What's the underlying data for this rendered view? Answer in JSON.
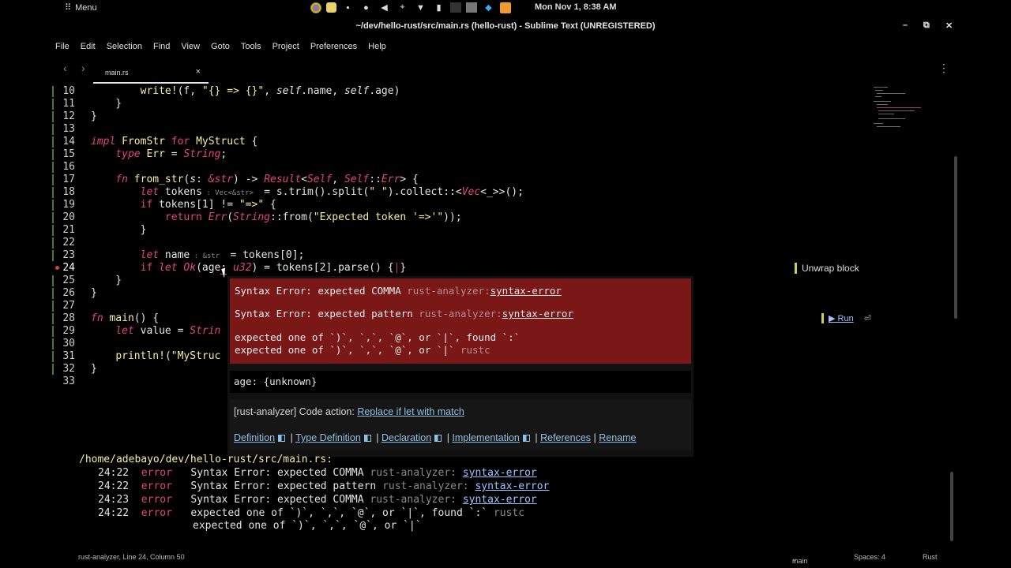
{
  "system": {
    "menu_label": "Menu",
    "clock": "Mon Nov  1,  8:38 AM",
    "tray_icons": [
      "chrome-icon",
      "camera-app-icon",
      "camera-icon",
      "microphone-icon",
      "volume-icon",
      "location-icon",
      "wifi-icon",
      "battery-icon",
      "terminal-icon",
      "files-icon",
      "vscode-icon",
      "sublime-icon"
    ]
  },
  "window": {
    "title": "~/dev/hello-rust/src/main.rs (hello-rust) - Sublime Text (UNREGISTERED)",
    "minimize": "–",
    "maximize": "⧉",
    "close": "✕"
  },
  "menu": [
    "File",
    "Edit",
    "Selection",
    "Find",
    "View",
    "Goto",
    "Tools",
    "Project",
    "Preferences",
    "Help"
  ],
  "tab": {
    "name": "main.rs",
    "close": "×"
  },
  "editor": {
    "current_line": "24",
    "lines": [
      {
        "n": "10"
      },
      {
        "n": "11"
      },
      {
        "n": "12"
      },
      {
        "n": "13"
      },
      {
        "n": "14"
      },
      {
        "n": "15"
      },
      {
        "n": "16"
      },
      {
        "n": "17"
      },
      {
        "n": "18"
      },
      {
        "n": "19"
      },
      {
        "n": "20"
      },
      {
        "n": "21"
      },
      {
        "n": "22"
      },
      {
        "n": "23"
      },
      {
        "n": "24"
      },
      {
        "n": "25"
      },
      {
        "n": "26"
      },
      {
        "n": "27"
      },
      {
        "n": "28"
      },
      {
        "n": "29"
      },
      {
        "n": "30"
      },
      {
        "n": "31"
      },
      {
        "n": "32"
      },
      {
        "n": "33"
      }
    ],
    "hint_vec": "Vec<&str>",
    "hint_str": "&str",
    "unwrap_block": "Unwrap block",
    "run_label": "▶ Run",
    "run_icon": "⏎"
  },
  "popup": {
    "e1_msg": "Syntax Error: expected COMMA ",
    "e1_src": "rust-analyzer",
    "e1_code": "syntax-error",
    "e2_msg": "Syntax Error: expected pattern ",
    "e2_src": "rust-analyzer",
    "e2_code": "syntax-error",
    "e3_line1": "expected one of `)`, `,`, `@`, or `|`, found `:`",
    "e3_line2": "expected one of `)`, `,`, `@`, or `|` ",
    "e3_src": "rustc",
    "hover": "age: {unknown}",
    "action_prefix": "[rust-analyzer] Code action: ",
    "action_link": "Replace if let with match",
    "links": [
      "Definition",
      "Type Definition",
      "Declaration",
      "Implementation",
      "References",
      "Rename"
    ]
  },
  "panel": {
    "path": "/home/adebayo/dev/hello-rust/src/main.rs:",
    "rows": [
      {
        "pos": "24:22",
        "level": "error",
        "msg": "Syntax Error: expected COMMA ",
        "src": "rust-analyzer:",
        "code": "syntax-error"
      },
      {
        "pos": "24:22",
        "level": "error",
        "msg": "Syntax Error: expected pattern ",
        "src": "rust-analyzer:",
        "code": "syntax-error"
      },
      {
        "pos": "24:23",
        "level": "error",
        "msg": "Syntax Error: expected COMMA ",
        "src": "rust-analyzer:",
        "code": "syntax-error"
      },
      {
        "pos": "24:22",
        "level": "error",
        "msg": "expected one of `)`, `,`, `@`, or `|`, found `:` ",
        "src": "rustc",
        "code": ""
      }
    ],
    "cont": "expected one of `)`, `,`, `@`, or `|`"
  },
  "status": {
    "left": "rust-analyzer, Line 24, Column 50",
    "branch": "main",
    "spaces": "Spaces: 4",
    "syntax": "Rust"
  }
}
